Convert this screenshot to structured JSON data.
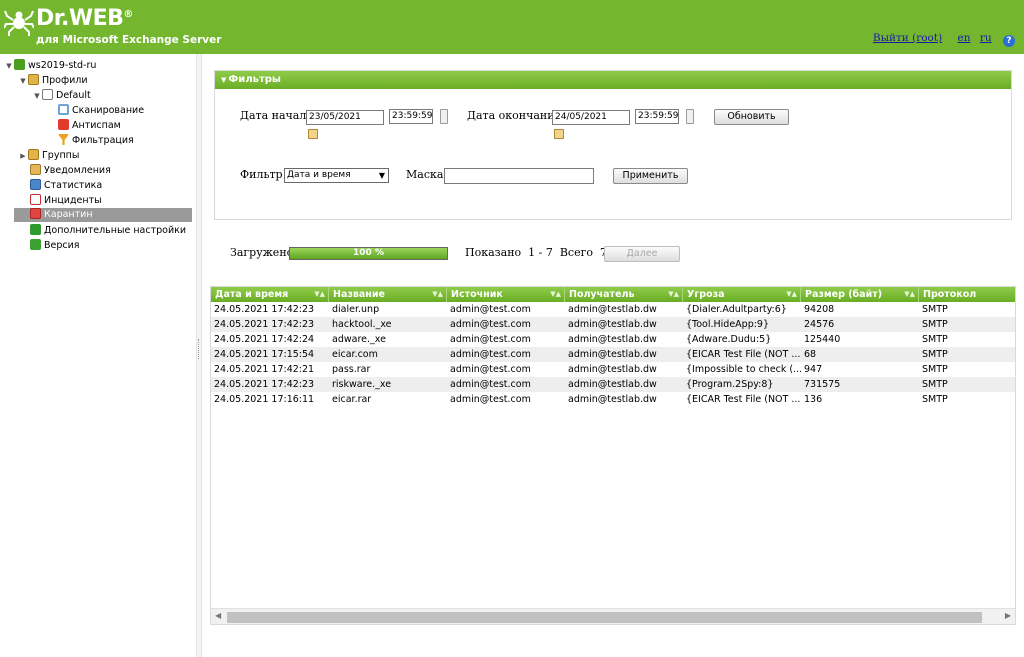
{
  "header": {
    "brand": "Dr.WEB",
    "brand_mark": "®",
    "subtitle": "для Microsoft Exchange Server",
    "logout_label": "Выйти (root)",
    "lang_en": "en",
    "lang_ru": "ru",
    "help_label": "?"
  },
  "sidebar": {
    "items": [
      {
        "label": "ws2019-std-ru",
        "icon": "server-icon",
        "toggle": "▼"
      },
      {
        "label": "Профили",
        "icon": "folder-icon",
        "toggle": "▼"
      },
      {
        "label": "Default",
        "icon": "profile-icon",
        "toggle": "▼"
      },
      {
        "label": "Сканирование",
        "icon": "magnifier-icon",
        "toggle": ""
      },
      {
        "label": "Антиспам",
        "icon": "antispam-icon",
        "toggle": ""
      },
      {
        "label": "Фильтрация",
        "icon": "funnel-icon",
        "toggle": ""
      },
      {
        "label": "Группы",
        "icon": "folder-icon",
        "toggle": "▶"
      },
      {
        "label": "Уведомления",
        "icon": "notification-icon",
        "toggle": ""
      },
      {
        "label": "Статистика",
        "icon": "statistics-icon",
        "toggle": ""
      },
      {
        "label": "Инциденты",
        "icon": "incidents-icon",
        "toggle": ""
      },
      {
        "label": "Карантин",
        "icon": "quarantine-icon",
        "toggle": ""
      },
      {
        "label": "Дополнительные настройки",
        "icon": "shield-icon",
        "toggle": ""
      },
      {
        "label": "Версия",
        "icon": "info-icon",
        "toggle": ""
      }
    ],
    "selected": "Карантин"
  },
  "filters": {
    "title": "Фильтры",
    "start_label": "Дата начала",
    "start_date": "23/05/2021",
    "start_time": "23:59:59",
    "end_label": "Дата окончания",
    "end_date": "24/05/2021",
    "end_time": "23:59:59",
    "refresh_label": "Обновить",
    "filter_label": "Фильтр",
    "filter_value": "Дата и время",
    "mask_label": "Маска",
    "mask_value": "",
    "apply_label": "Применить"
  },
  "progress": {
    "loaded_label": "Загружено",
    "percent": 100,
    "percent_text": "100 %",
    "shown_text": "Показано  1 - 7  Всего  7",
    "next_label": "Далее"
  },
  "table": {
    "columns": [
      "Дата и время",
      "Название",
      "Источник",
      "Получатель",
      "Угроза",
      "Размер (байт)",
      "Протокол"
    ],
    "rows": [
      [
        "24.05.2021 17:42:23",
        "dialer.unp",
        "admin@test.com",
        "admin@testlab.dw",
        "{Dialer.Adultparty:6}",
        "94208",
        "SMTP"
      ],
      [
        "24.05.2021 17:42:23",
        "hacktool._xe",
        "admin@test.com",
        "admin@testlab.dw",
        "{Tool.HideApp:9}",
        "24576",
        "SMTP"
      ],
      [
        "24.05.2021 17:42:24",
        "adware._xe",
        "admin@test.com",
        "admin@testlab.dw",
        "{Adware.Dudu:5}",
        "125440",
        "SMTP"
      ],
      [
        "24.05.2021 17:15:54",
        "eicar.com",
        "admin@test.com",
        "admin@testlab.dw",
        "{EICAR Test File (NOT ...",
        "68",
        "SMTP"
      ],
      [
        "24.05.2021 17:42:21",
        "pass.rar",
        "admin@test.com",
        "admin@testlab.dw",
        "{Impossible to check (...",
        "947",
        "SMTP"
      ],
      [
        "24.05.2021 17:42:23",
        "riskware._xe",
        "admin@test.com",
        "admin@testlab.dw",
        "{Program.2Spy:8}",
        "731575",
        "SMTP"
      ],
      [
        "24.05.2021 17:16:11",
        "eicar.rar",
        "admin@test.com",
        "admin@testlab.dw",
        "{EICAR Test File (NOT ...",
        "136",
        "SMTP"
      ]
    ]
  },
  "colors": {
    "brand_green": "#74b72e",
    "selected_gray": "#9a9a9a",
    "link_blue": "#1a1aa6"
  }
}
